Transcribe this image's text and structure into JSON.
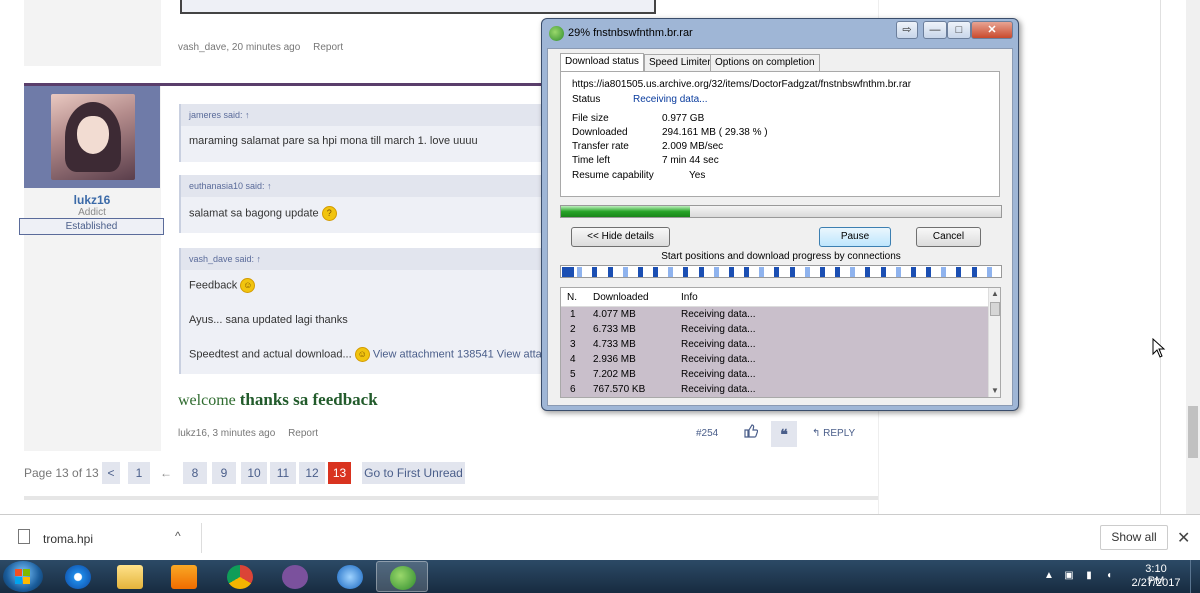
{
  "forum": {
    "post1_meta": {
      "author": "vash_dave, 20 minutes ago",
      "report": "Report"
    },
    "user": {
      "name": "lukz16",
      "title": "Addict",
      "banner": "Established"
    },
    "quotes": [
      {
        "head": "jameres said: ↑",
        "body": "maraming salamat pare sa hpi mona till march 1. love uuuu"
      },
      {
        "head": "euthanasia10 said: ↑",
        "body": "salamat sa bagong update"
      },
      {
        "head": "vash_dave said: ↑",
        "line1": "Feedback",
        "line2": "Ayus... sana updated lagi thanks",
        "line3": "Speedtest and actual download...",
        "line3_link": "View attachment 138541 View attachment"
      }
    ],
    "reply_text": {
      "pre": "welcome",
      "bold": "thanks sa feedback"
    },
    "post2_meta": {
      "author": "lukz16, 3 minutes ago",
      "report": "Report"
    },
    "post_number": "#254",
    "quote_icon": "❝",
    "reply_label": "↰ REPLY",
    "pager": {
      "label": "Page 13 of 13",
      "prev": "<",
      "first": "1",
      "back_arrow": "←",
      "pages": [
        "8",
        "9",
        "10",
        "11",
        "12"
      ],
      "current": "13",
      "goto_label": "Go to First Unread"
    }
  },
  "idm": {
    "title": "29% fnstnbswfnthm.br.rar",
    "controls": {
      "minimize_to_tray": "⇨",
      "minimize": "—",
      "maximize": "□",
      "close": "✕"
    },
    "tabs": [
      "Download status",
      "Speed Limiter",
      "Options on completion"
    ],
    "url": "https://ia801505.us.archive.org/32/items/DoctorFadgzat/fnstnbswfnthm.br.rar",
    "status_label": "Status",
    "status_value": "Receiving data...",
    "fields": [
      {
        "label": "File size",
        "value": "0.977  GB"
      },
      {
        "label": "Downloaded",
        "value": "294.161  MB  ( 29.38 % )"
      },
      {
        "label": "Transfer rate",
        "value": "2.009  MB/sec"
      },
      {
        "label": "Time left",
        "value": "7 min 44 sec"
      },
      {
        "label": "Resume capability",
        "value": "Yes"
      }
    ],
    "progress_fraction": 0.2938,
    "buttons": {
      "hide_details": "<< Hide details",
      "pause": "Pause",
      "cancel": "Cancel"
    },
    "connections_label": "Start positions and download progress by connections",
    "table_head": {
      "n": "N.",
      "downloaded": "Downloaded",
      "info": "Info"
    },
    "connections": [
      {
        "n": "1",
        "downloaded": "4.077  MB",
        "info": "Receiving data..."
      },
      {
        "n": "2",
        "downloaded": "6.733  MB",
        "info": "Receiving data..."
      },
      {
        "n": "3",
        "downloaded": "4.733  MB",
        "info": "Receiving data..."
      },
      {
        "n": "4",
        "downloaded": "2.936  MB",
        "info": "Receiving data..."
      },
      {
        "n": "5",
        "downloaded": "7.202  MB",
        "info": "Receiving data..."
      },
      {
        "n": "6",
        "downloaded": "767.570  KB",
        "info": "Receiving data..."
      }
    ]
  },
  "downloads_bar": {
    "file_name": "troma.hpi",
    "chevron": "^",
    "show_all": "Show all",
    "close": "✕"
  },
  "taskbar": {
    "apps": [
      "windows-start",
      "internet-explorer",
      "file-explorer",
      "media-player",
      "google-chrome",
      "viber",
      "network-app",
      "internet-download-manager"
    ],
    "tray": {
      "arrow": "▲",
      "time": "3:10 PM",
      "date": "2/27/2017"
    }
  },
  "colors": {
    "accent_blue": "#4a5e8a",
    "current_page": "#d9331f",
    "progress_green": "#28a428",
    "taskbar": "#1f3a55"
  }
}
